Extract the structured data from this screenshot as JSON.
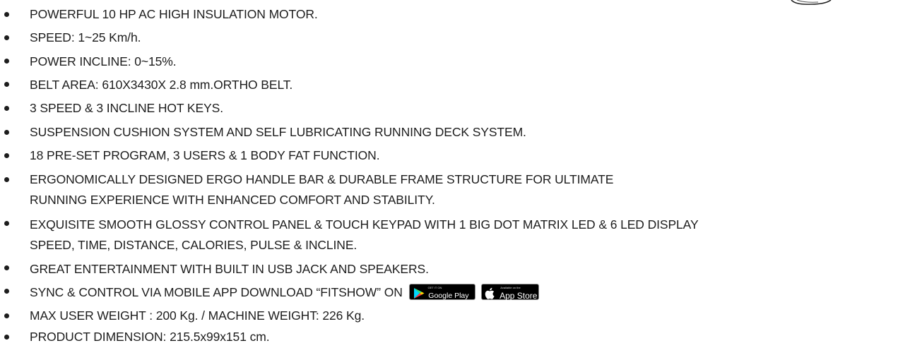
{
  "specs": [
    {
      "text": "POWERFUL 10 HP AC HIGH INSULATION MOTOR."
    },
    {
      "text": "SPEED: 1~25 Km/h."
    },
    {
      "text": "POWER INCLINE: 0~15%."
    },
    {
      "text": "BELT AREA: 610X3430X 2.8 mm.ORTHO BELT."
    },
    {
      "text": "3 SPEED & 3 INCLINE HOT KEYS."
    },
    {
      "text": "SUSPENSION CUSHION SYSTEM AND SELF LUBRICATING RUNNING DECK SYSTEM."
    },
    {
      "text": "18 PRE-SET PROGRAM, 3 USERS & 1 BODY FAT FUNCTION."
    },
    {
      "text": "ERGONOMICALLY DESIGNED ERGO HANDLE BAR & DURABLE FRAME STRUCTURE FOR ULTIMATE",
      "text2": "RUNNING EXPERIENCE WITH ENHANCED COMFORT AND STABILITY."
    },
    {
      "text": "EXQUISITE SMOOTH GLOSSY CONTROL PANEL & TOUCH  KEYPAD WITH 1 BIG DOT MATRIX LED & 6 LED DISPLAY",
      "text2": "SPEED, TIME, DISTANCE, CALORIES, PULSE & INCLINE."
    },
    {
      "text": "GREAT ENTERTAINMENT WITH BUILT IN USB JACK AND  SPEAKERS."
    },
    {
      "text": "SYNC & CONTROL VIA MOBILE APP DOWNLOAD “FITSHOW” ON"
    },
    {
      "text": "MAX USER WEIGHT : 200 Kg. / MACHINE WEIGHT: 226 Kg."
    },
    {
      "text": "PRODUCT DIMENSION: 215.5x99x151 cm."
    }
  ],
  "badges": {
    "google_play": {
      "small": "GET IT ON",
      "big": "Google Play",
      "icon": "google-play-icon"
    },
    "app_store": {
      "small": "Available on the",
      "big": "App Store",
      "icon": "apple-icon"
    }
  }
}
